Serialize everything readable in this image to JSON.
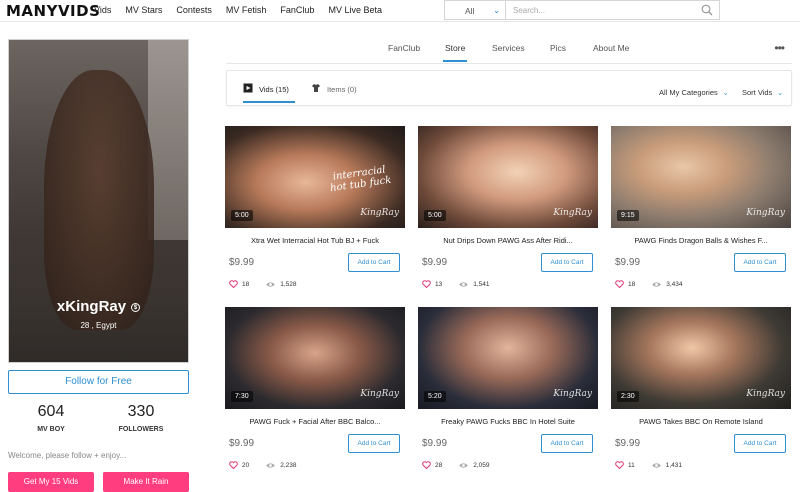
{
  "header": {
    "logo": "MANYVIDS",
    "nav": [
      "Vids",
      "MV Stars",
      "Contests",
      "MV Fetish",
      "FanClub",
      "MV Live Beta"
    ],
    "search_category": "All",
    "search_placeholder": "Search..."
  },
  "profile": {
    "name": "xKingRay",
    "location": "28 , Egypt",
    "follow_label": "Follow for Free",
    "stats": [
      {
        "value": "604",
        "label": "MV BOY"
      },
      {
        "value": "330",
        "label": "FOLLOWERS"
      }
    ],
    "welcome": "Welcome, please follow + enjoy...",
    "buttons": [
      "Get My 15 Vids",
      "Make It Rain"
    ]
  },
  "tabs": [
    "FanClub",
    "Store",
    "Services",
    "Pics",
    "About Me"
  ],
  "active_tab": "Store",
  "subtabs": {
    "vids": "Vids (15)",
    "items": "Items (0)",
    "categories": "All My Categories",
    "sort": "Sort Vids"
  },
  "colors": {
    "accent": "#2f8fd0",
    "pink": "#ff3d7f",
    "heart": "#e0407a"
  },
  "videos": [
    {
      "title": "Xtra Wet Interracial Hot Tub BJ + Fuck",
      "duration": "5:00",
      "price": "$9.99",
      "likes": "18",
      "views": "1,528",
      "cart": "Add to Cart",
      "watermark": "KingRay",
      "overlay": "interracial hot tub fuck"
    },
    {
      "title": "Nut Drips Down PAWG Ass After Ridi...",
      "duration": "5:00",
      "price": "$9.99",
      "likes": "13",
      "views": "1,541",
      "cart": "Add to Cart",
      "watermark": "KingRay"
    },
    {
      "title": "PAWG Finds Dragon Balls & Wishes F...",
      "duration": "9:15",
      "price": "$9.99",
      "likes": "18",
      "views": "3,434",
      "cart": "Add to Cart",
      "watermark": "KingRay"
    },
    {
      "title": "PAWG Fuck + Facial After BBC Balco...",
      "duration": "7:30",
      "price": "$9.99",
      "likes": "20",
      "views": "2,238",
      "cart": "Add to Cart",
      "watermark": "KingRay"
    },
    {
      "title": "Freaky PAWG Fucks BBC In Hotel Suite",
      "duration": "5:20",
      "price": "$9.99",
      "likes": "28",
      "views": "2,059",
      "cart": "Add to Cart",
      "watermark": "KingRay"
    },
    {
      "title": "PAWG Takes BBC On Remote Island",
      "duration": "2:30",
      "price": "$9.99",
      "likes": "11",
      "views": "1,431",
      "cart": "Add to Cart",
      "watermark": "KingRay"
    }
  ]
}
